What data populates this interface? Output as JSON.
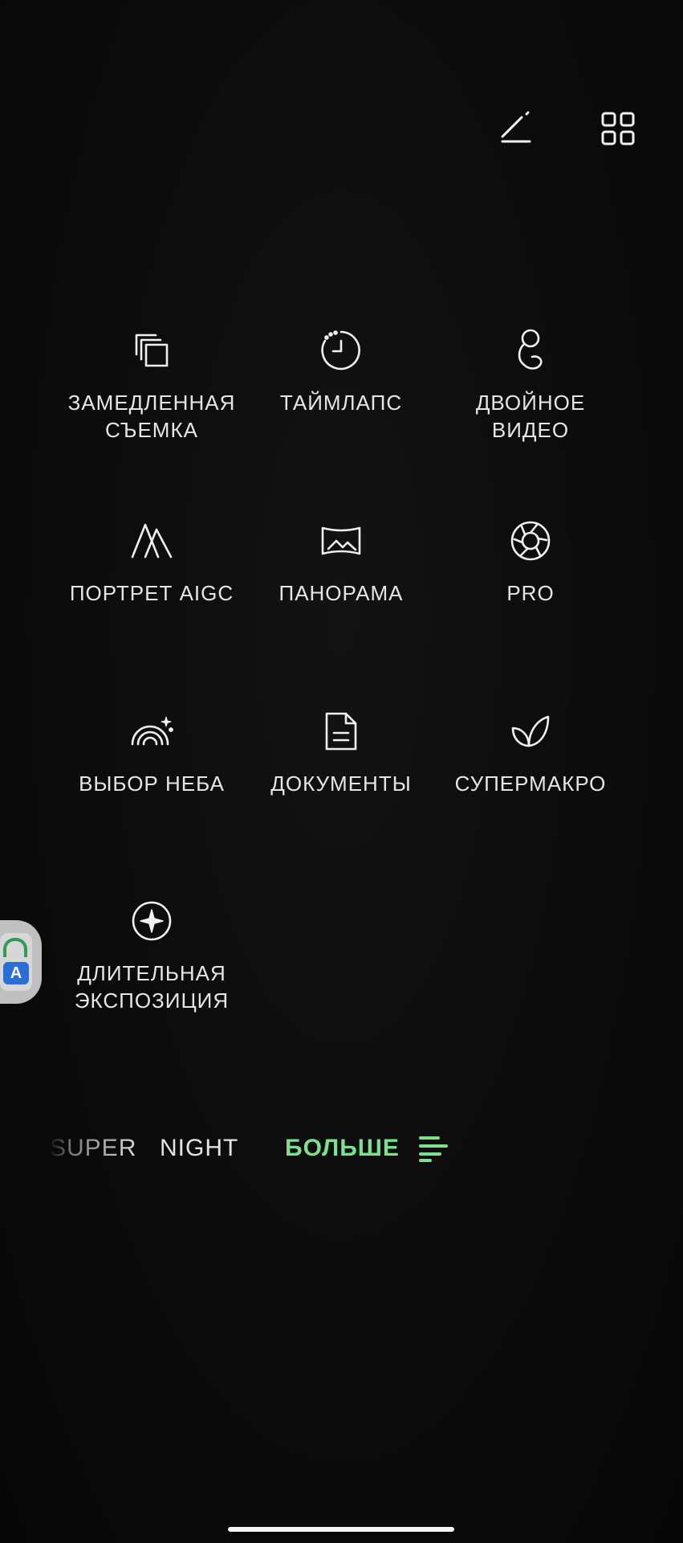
{
  "top_bar": {
    "icons": [
      "edit-slash-icon",
      "grid-icon"
    ]
  },
  "modes": [
    {
      "label": "ЗАМЕДЛЕННАЯ\nСЪЕМКА",
      "icon": "slow-motion-icon"
    },
    {
      "label": "ТАЙМЛАПС",
      "icon": "timelapse-icon"
    },
    {
      "label": "ДВОЙНОЕ\nВИДЕО",
      "icon": "dual-video-icon"
    },
    {
      "label": "ПОРТРЕТ AIGC",
      "icon": "portrait-aigc-icon"
    },
    {
      "label": "ПАНОРАМА",
      "icon": "panorama-icon"
    },
    {
      "label": "PRO",
      "icon": "aperture-icon"
    },
    {
      "label": "ВЫБОР НЕБА",
      "icon": "sky-rainbow-icon"
    },
    {
      "label": "ДОКУМЕНТЫ",
      "icon": "document-icon"
    },
    {
      "label": "СУПЕРМАКРО",
      "icon": "leaf-icon"
    },
    {
      "label": "ДЛИТЕЛЬНАЯ\nЭКСПОЗИЦИЯ",
      "icon": "star-circle-icon"
    }
  ],
  "floating_app": {
    "letter": "A"
  },
  "mode_strip": {
    "faded_item": "SUPER",
    "night_item": "NIGHT",
    "more_label": "БОЛЬШЕ",
    "more_icon": "list-icon",
    "active_color": "#7ce08c"
  }
}
